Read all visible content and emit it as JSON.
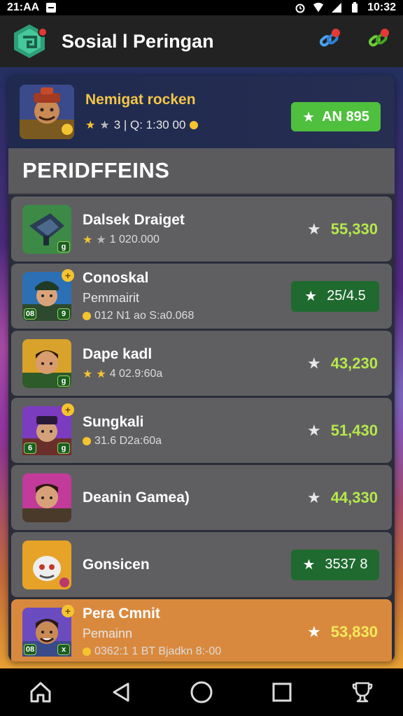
{
  "status_bar": {
    "time_left": "21:AA",
    "time_right": "10:32"
  },
  "app_bar": {
    "title": "Sosial l Peringan"
  },
  "featured": {
    "name": "Nemigat rocken",
    "meta": "3 | Q: 1:30 00",
    "button_label": "AN 895"
  },
  "leaderboard": {
    "title": "PERIDFFEINS",
    "rows": [
      {
        "name": "Dalsek Draiget",
        "sub": "",
        "meta": "1 020.000",
        "score": "55,330",
        "pill": false,
        "highlight": false
      },
      {
        "name": "Conoskal",
        "sub": "Pemmairit",
        "meta": "012 N1 ao S:a0.068",
        "score": "25/4.5",
        "pill": true,
        "highlight": false
      },
      {
        "name": "Dape kadl",
        "sub": "",
        "meta": "4 02.9:60a",
        "score": "43,230",
        "pill": false,
        "highlight": false
      },
      {
        "name": "Sungkali",
        "sub": "",
        "meta": "31.6 D2a:60a",
        "score": "51,430",
        "pill": false,
        "highlight": false
      },
      {
        "name": "Deanin Gamea)",
        "sub": "",
        "meta": "",
        "score": "44,330",
        "pill": false,
        "highlight": false
      },
      {
        "name": "Gonsicen",
        "sub": "",
        "meta": "",
        "score": "3537 8",
        "pill": true,
        "highlight": false
      },
      {
        "name": "Pera Cmnit",
        "sub": "Pemainn",
        "meta": "0362:1 1 BT Bjadkn 8:-00",
        "score": "53,830",
        "pill": false,
        "highlight": true
      }
    ]
  },
  "colors": {
    "accent_green": "#4fbf3e",
    "score_green": "#b6e84a",
    "highlight_orange": "#d9893e",
    "gold": "#f3c54a"
  },
  "icons": {
    "app_logo": "app-logo-icon",
    "action_1": "link-icon",
    "action_2": "link-icon",
    "nav": [
      "home-icon",
      "back-icon",
      "circle-home-icon",
      "recents-icon",
      "trophy-icon"
    ]
  }
}
